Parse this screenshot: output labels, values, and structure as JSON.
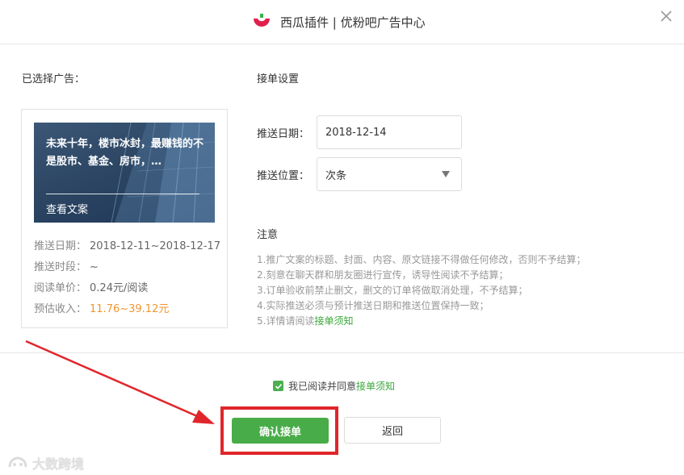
{
  "header": {
    "title": "西瓜插件 | 优粉吧广告中心",
    "logo_icon": "brand-logo-icon",
    "close_icon": "close-icon"
  },
  "selected_ad": {
    "section_label": "已选择广告：",
    "title": "未来十年，楼市冰封，最赚钱的不是股市、基金、房市，…",
    "view_link": "查看文案",
    "push_date_label": "推送日期：",
    "push_date_value": "2018-12-11~2018-12-17",
    "push_period_label": "推送时段：",
    "push_period_value": "~",
    "unit_price_label": "阅读单价：",
    "unit_price_value": "0.24元/阅读",
    "est_income_label": "预估收入：",
    "est_income_value": "11.76~39.12元",
    "income_color": "#f0962e"
  },
  "settings": {
    "section_label": "接单设置",
    "date_label": "推送日期：",
    "date_value": "2018-12-14",
    "position_label": "推送位置：",
    "position_value": "次条"
  },
  "notice": {
    "title": "注意",
    "items": [
      "1.推广文案的标题、封面、内容、原文链接不得做任何修改，否则不予结算；",
      "2.刻意在聊天群和朋友圈进行宣传，诱导性阅读不予结算；",
      "3.订单验收前禁止删文，删文的订单将做取消处理，不予结算；",
      "4.实际推送必须与预计推送日期和推送位置保持一致；"
    ],
    "item5_prefix": "5.详情请阅读",
    "item5_link": "接单须知",
    "link_color": "#3aa83a"
  },
  "footer": {
    "agree_text": "我已阅读并同意",
    "agree_link": "接单须知",
    "agree_checked": true,
    "confirm_label": "确认接单",
    "back_label": "返回",
    "confirm_color": "#48ad48",
    "highlight_color": "#e0262b"
  },
  "watermark": {
    "text": "大数跨境"
  }
}
